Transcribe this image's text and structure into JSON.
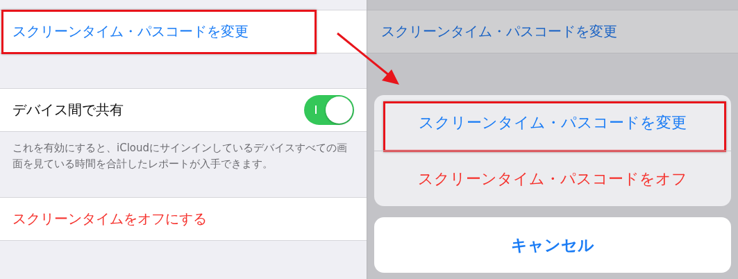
{
  "settings": {
    "passcode_row": {
      "label": "スクリーンタイム・パスコードを変更",
      "highlighted": true
    },
    "share_row": {
      "label": "デバイス間で共有",
      "on": true
    },
    "share_footer": "これを有効にすると、iCloudにサインインしているデバイスすべての画面を見ている時間を合計したレポートが入手できます。",
    "turn_off_row": {
      "label": "スクリーンタイムをオフにする"
    }
  },
  "background_screen": {
    "passcode_row": {
      "label": "スクリーンタイム・パスコードを変更"
    }
  },
  "action_sheet": {
    "actions": [
      {
        "label": "スクリーンタイム・パスコードを変更",
        "kind": "default",
        "highlighted": true
      },
      {
        "label": "スクリーンタイム・パスコードをオフ",
        "kind": "destructive",
        "highlighted": false
      }
    ],
    "cancel": "キャンセル"
  }
}
